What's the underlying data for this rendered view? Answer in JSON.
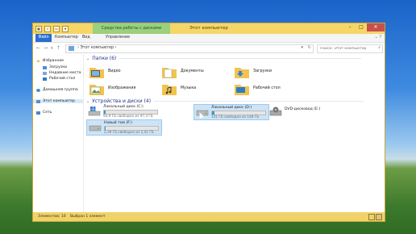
{
  "window": {
    "title": "Этот компьютер",
    "context_tab": "Средства работы с дисками",
    "tabs": [
      "Файл",
      "Компьютер",
      "Вид",
      "Управление"
    ]
  },
  "address": {
    "breadcrumb": "Этот компьютер",
    "search_placeholder": "Поиск: Этот компьютер"
  },
  "sidebar": {
    "items": [
      {
        "label": "Избранное",
        "icon": "star-icon"
      },
      {
        "label": "Загрузки",
        "icon": "downloads-icon"
      },
      {
        "label": "Недавние места",
        "icon": "recent-places-icon"
      },
      {
        "label": "Рабочий стол",
        "icon": "desktop-icon"
      },
      {
        "label": "Домашняя группа",
        "icon": "homegroup-icon"
      },
      {
        "label": "Этот компьютер",
        "icon": "computer-icon"
      },
      {
        "label": "Сеть",
        "icon": "network-icon"
      }
    ]
  },
  "sections": {
    "folders": "Папки (6)",
    "drives": "Устройства и диски (4)"
  },
  "folders": [
    {
      "name": "Видео",
      "icon": "video-folder-icon"
    },
    {
      "name": "Документы",
      "icon": "documents-folder-icon"
    },
    {
      "name": "Загрузки",
      "icon": "downloads-folder-icon"
    },
    {
      "name": "Изображения",
      "icon": "pictures-folder-icon"
    },
    {
      "name": "Музыка",
      "icon": "music-folder-icon"
    },
    {
      "name": "Рабочий стол",
      "icon": "desktop-folder-icon"
    }
  ],
  "drives": [
    {
      "name": "Локальный диск (C:)",
      "free": "93,9 ГБ свободно из 97,3 ГБ",
      "used_fraction": 0.035,
      "icon": "windows-drive-icon"
    },
    {
      "name": "Локальный диск (D:)",
      "free": "141 ГБ свободно из 148 ГБ",
      "used_fraction": 0.05,
      "icon": "hard-drive-icon"
    },
    {
      "name": "DVD-дисковод (E:)",
      "icon": "dvd-drive-icon"
    },
    {
      "name": "Новый том (F:)",
      "free": "2,39 ГБ свободно из 2,41 ГБ",
      "used_fraction": 0.01,
      "icon": "hard-drive-icon"
    }
  ],
  "status": {
    "items": "Элементов: 10",
    "selected": "Выбран 1 элемент"
  },
  "colors": {
    "frame": "#f0d26a",
    "context_tab": "#9ad07e",
    "file_tab": "#2a6ed0",
    "selection": "#cde4f7",
    "progress": "#26a0da",
    "close": "#c7504b"
  }
}
